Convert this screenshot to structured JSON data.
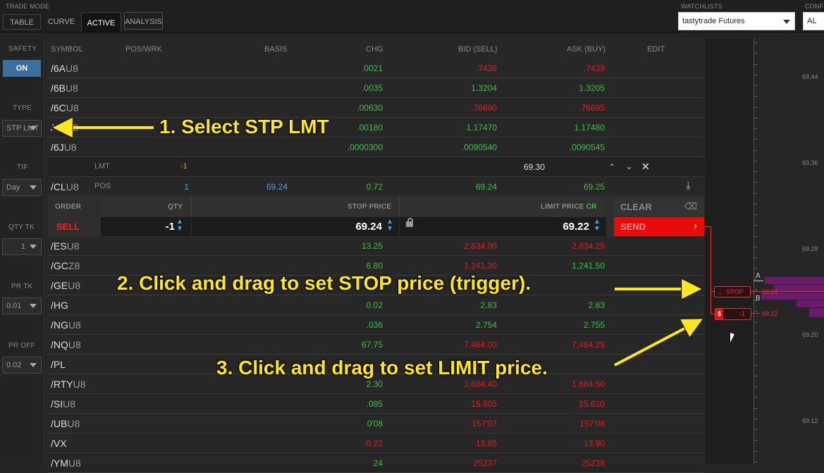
{
  "trade_mode": {
    "label": "TRADE MODE",
    "tabs": [
      "TABLE",
      "CURVE",
      "ACTIVE",
      "ANALYSIS"
    ],
    "active": "ACTIVE"
  },
  "watchlists": {
    "label": "WATCHLISTS",
    "selected": "tastytrade Futures"
  },
  "config": {
    "label": "CONF",
    "value": "AL"
  },
  "sidebar": {
    "safety": {
      "label": "SAFETY",
      "value": "ON"
    },
    "type": {
      "label": "TYPE",
      "value": "STP LMT"
    },
    "tif": {
      "label": "TIF",
      "value": "Day"
    },
    "qty_tk": {
      "label": "QTY TK",
      "value": "1"
    },
    "pr_tk": {
      "label": "PR TK",
      "value": "0.01"
    },
    "pr_off": {
      "label": "PR OFF",
      "value": "0.02"
    }
  },
  "table": {
    "headers": {
      "symbol": "SYMBOL",
      "pos_wrk": "POS/WRK",
      "basis": "BASIS",
      "chg": "CHG",
      "bid": "BID (SELL)",
      "ask": "ASK (BUY)",
      "edit": "EDIT"
    },
    "rows_top": [
      {
        "root": "/6A",
        "month": "U8",
        "chg": ".0021",
        "bid": ".7438",
        "ask": ".7439",
        "bid_c": "r",
        "ask_c": "r"
      },
      {
        "root": "/6B",
        "month": "U8",
        "chg": ".0035",
        "bid": "1.3204",
        "ask": "1.3205",
        "bid_c": "g",
        "ask_c": "g"
      },
      {
        "root": "/6C",
        "month": "U8",
        "chg": ".00630",
        "bid": ".76690",
        "ask": ".76695",
        "bid_c": "r",
        "ask_c": "r"
      },
      {
        "root": "/6E",
        "month": "U8",
        "chg": ".00180",
        "bid": "1.17470",
        "ask": "1.17480",
        "bid_c": "g",
        "ask_c": "g"
      },
      {
        "root": "/6J",
        "month": "U8",
        "chg": ".0000300",
        "bid": ".0090540",
        "ask": ".0090545",
        "bid_c": "g",
        "ask_c": "g"
      }
    ],
    "lmt_row": {
      "label": "LMT",
      "wrk": "-1",
      "price": "69.30"
    },
    "cl_row": {
      "root": "/CL",
      "month": "U8",
      "pos_label": "POS",
      "pos": "1",
      "basis": "69.24",
      "chg": "0.72",
      "bid": "69.24",
      "ask": "69.25"
    },
    "rows_bottom": [
      {
        "root": "/ES",
        "month": "U8",
        "chg": "13.25",
        "bid": "2,834.00",
        "ask": "2,834.25",
        "bid_c": "r",
        "ask_c": "r"
      },
      {
        "root": "/GC",
        "month": "Z8",
        "chg": "6.80",
        "bid": "1,241.30",
        "ask": "1,241.50",
        "bid_c": "r",
        "ask_c": "g"
      },
      {
        "root": "/GE",
        "month": "U8",
        "chg": "",
        "bid": "",
        "ask": "",
        "bid_c": "g",
        "ask_c": "g"
      },
      {
        "root": "/HG",
        "month": "",
        "chg": "0.02",
        "bid": "2.83",
        "ask": "2.83",
        "bid_c": "g",
        "ask_c": "g"
      },
      {
        "root": "/NG",
        "month": "U8",
        "chg": ".036",
        "bid": "2.754",
        "ask": "2.755",
        "bid_c": "g",
        "ask_c": "g"
      },
      {
        "root": "/NQ",
        "month": "U8",
        "chg": "67.75",
        "bid": "7,484.00",
        "ask": "7,484.25",
        "bid_c": "r",
        "ask_c": "r"
      },
      {
        "root": "/PL",
        "month": "",
        "chg": "",
        "bid": "",
        "ask": "",
        "bid_c": "r",
        "ask_c": "r"
      },
      {
        "root": "/RTY",
        "month": "U8",
        "chg": "2.30",
        "bid": "1,684.40",
        "ask": "1,684.50",
        "bid_c": "r",
        "ask_c": "r"
      },
      {
        "root": "/SI",
        "month": "U8",
        "chg": ".085",
        "bid": "15.605",
        "ask": "15.610",
        "bid_c": "r",
        "ask_c": "r"
      },
      {
        "root": "/UB",
        "month": "U8",
        "chg": "0'08",
        "bid": "157'07",
        "ask": "157'08",
        "bid_c": "r",
        "ask_c": "r"
      },
      {
        "root": "/VX",
        "month": "",
        "chg": "-0.22",
        "bid": "13.85",
        "ask": "13.90",
        "bid_c": "r",
        "ask_c": "r",
        "chg_c": "r"
      },
      {
        "root": "/YM",
        "month": "U8",
        "chg": "24",
        "bid": "25237",
        "ask": "25238",
        "bid_c": "r",
        "ask_c": "r"
      }
    ]
  },
  "order_entry": {
    "order_label": "ORDER",
    "side": "SELL",
    "qty_label": "QTY",
    "qty": "-1",
    "stop_label": "STOP PRICE",
    "stop": "69.24",
    "limit_label": "LIMIT PRICE",
    "limit_suffix": "CR",
    "limit": "69.22",
    "clear": "CLEAR",
    "send": "SEND"
  },
  "ladder": {
    "prices": [
      "69.44",
      "69.36",
      "69.28",
      "69.20",
      "69.12"
    ],
    "stop_tag": "STOP",
    "stop_price": "69.24",
    "limit_tag": "$",
    "limit_qty": "-1",
    "limit_price": "69.22",
    "a_mark": "A",
    "b_mark": "B"
  },
  "annotations": {
    "step1": "1. Select STP LMT",
    "step2": "2. Click and drag to set STOP price (trigger).",
    "step3": "3. Click and drag to set LIMIT price."
  },
  "colors": {
    "green": "#3fc13f",
    "red": "#e81c1c",
    "send_bg": "#e80b0b",
    "annotation": "#ffe71a",
    "ladder_bar": "#6c1a6c"
  }
}
